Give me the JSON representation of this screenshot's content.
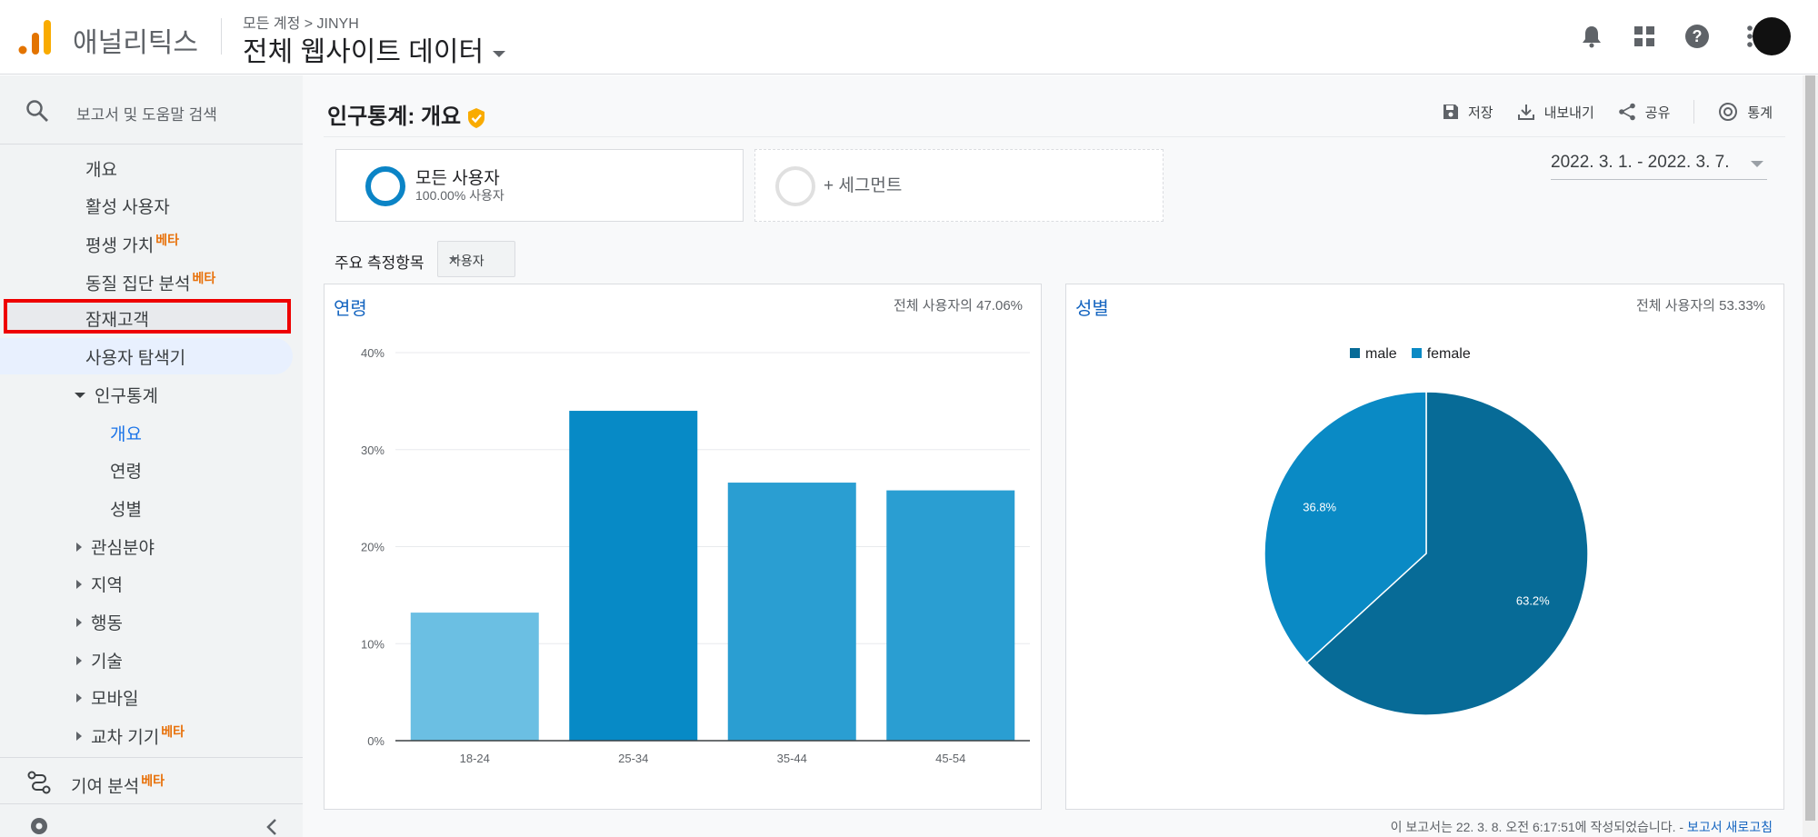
{
  "app": {
    "name": "애널리틱스",
    "breadcrumb": "모든 계정 > JINYH",
    "property": "전체 웹사이트 데이터"
  },
  "search": {
    "placeholder": "보고서 및 도움말 검색"
  },
  "sidebar": {
    "items": [
      {
        "label": "개요"
      },
      {
        "label": "활성 사용자"
      },
      {
        "label": "평생 가치",
        "badge": "베타"
      },
      {
        "label": "동질 집단 분석",
        "badge": "베타"
      },
      {
        "label": "잠재고객"
      },
      {
        "label": "사용자 탐색기"
      },
      {
        "label": "인구통계"
      },
      {
        "label": "개요"
      },
      {
        "label": "연령"
      },
      {
        "label": "성별"
      },
      {
        "label": "관심분야"
      },
      {
        "label": "지역"
      },
      {
        "label": "행동"
      },
      {
        "label": "기술"
      },
      {
        "label": "모바일"
      },
      {
        "label": "교차 기기",
        "badge": "베타"
      }
    ],
    "attribution": {
      "label": "기여 분석",
      "badge": "베타"
    }
  },
  "page": {
    "title": "인구통계: 개요"
  },
  "actions": {
    "save": "저장",
    "export": "내보내기",
    "share": "공유",
    "insights": "통계"
  },
  "segment": {
    "title": "모든 사용자",
    "sub": "100.00% 사용자",
    "add": "+ 세그먼트"
  },
  "date_range": "2022. 3. 1. - 2022. 3. 7.",
  "metric": {
    "label": "주요 측정항목",
    "value": "사용자"
  },
  "age_card": {
    "title": "연령",
    "note": "전체 사용자의 47.06%"
  },
  "gender_card": {
    "title": "성별",
    "note": "전체 사용자의 53.33%"
  },
  "footer": {
    "text": "이 보고서는 22. 3. 8. 오전 6:17:51에 작성되었습니다. - ",
    "link": "보고서 새로고침"
  },
  "colors": {
    "male": "#076b97",
    "female": "#0a8ac5"
  },
  "chart_data": [
    {
      "type": "bar",
      "title": "연령",
      "categories": [
        "18-24",
        "25-34",
        "35-44",
        "45-54"
      ],
      "values": [
        13.2,
        34.0,
        26.6,
        25.8
      ],
      "colors": [
        "#6bbfe3",
        "#078ac6",
        "#2a9ed2",
        "#2a9ed2"
      ],
      "yticks": [
        "0%",
        "10%",
        "20%",
        "30%",
        "40%"
      ],
      "ylim": [
        0,
        40
      ]
    },
    {
      "type": "pie",
      "title": "성별",
      "labels": [
        "male",
        "female"
      ],
      "values": [
        63.2,
        36.8
      ],
      "value_labels": [
        "63.2%",
        "36.8%"
      ],
      "colors": [
        "#076b97",
        "#0a8ac5"
      ],
      "legend": "top"
    }
  ]
}
